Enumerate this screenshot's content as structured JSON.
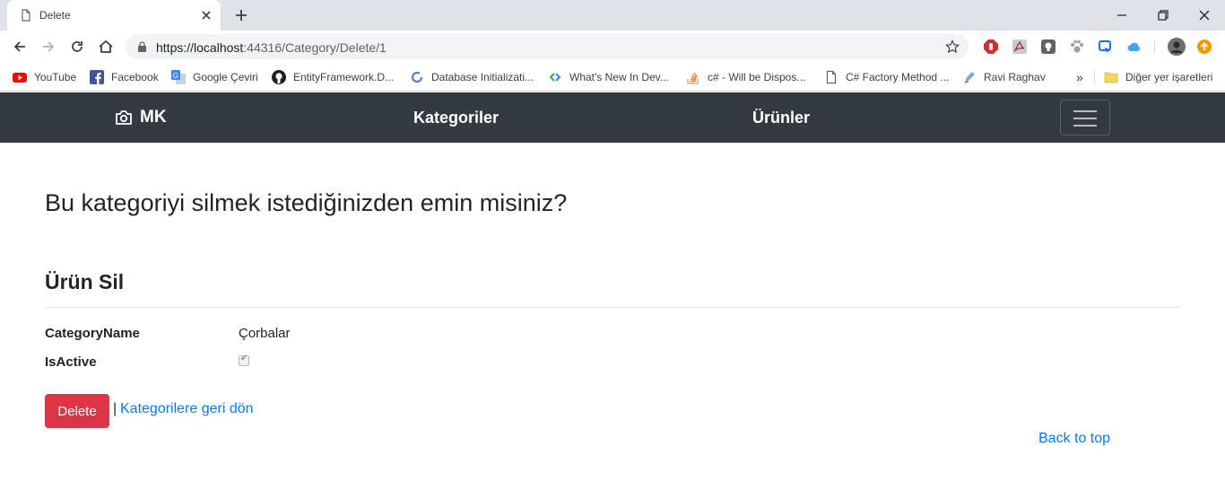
{
  "browser": {
    "tab_title": "Delete",
    "url_host": "https://localhost",
    "url_rest": ":44316/Category/Delete/1",
    "bookmarks": [
      {
        "label": "YouTube",
        "icon": "youtube-icon"
      },
      {
        "label": "Facebook",
        "icon": "facebook-icon"
      },
      {
        "label": "Google Çeviri",
        "icon": "google-translate-icon"
      },
      {
        "label": "EntityFramework.D...",
        "icon": "github-icon"
      },
      {
        "label": "Database Initializati...",
        "icon": "page-icon"
      },
      {
        "label": "What's New In Dev...",
        "icon": "page-icon"
      },
      {
        "label": "c# - Will be Dispos...",
        "icon": "stackoverflow-icon"
      },
      {
        "label": "C# Factory Method ...",
        "icon": "page-icon"
      },
      {
        "label": "Ravi Raghav",
        "icon": "page-icon"
      }
    ],
    "other_bookmarks": "Diğer yer işaretleri",
    "overflow": "»"
  },
  "navbar": {
    "brand": "MK",
    "links": [
      "Kategoriler",
      "Ürünler"
    ]
  },
  "page": {
    "question": "Bu kategoriyi silmek istediğinizden emin misiniz?",
    "section_title": "Ürün Sil",
    "fields": [
      {
        "label": "CategoryName",
        "value": "Çorbalar"
      },
      {
        "label": "IsActive",
        "value": "checked"
      }
    ],
    "delete_label": "Delete",
    "separator": "|",
    "back_link": "Kategorilere geri dön",
    "back_to_top": "Back to top"
  },
  "colors": {
    "navbar_bg": "#343a40",
    "danger": "#dc3545",
    "link": "#007bff"
  }
}
